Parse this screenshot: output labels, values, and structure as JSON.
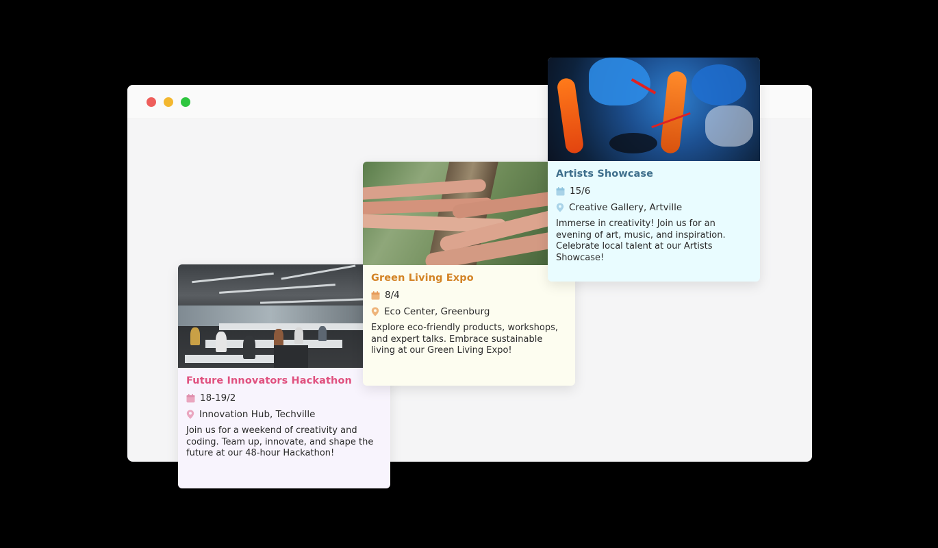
{
  "window": {
    "controls": [
      "close",
      "minimize",
      "maximize"
    ]
  },
  "events": [
    {
      "title": "Future Innovators Hackathon",
      "date": "18-19/2",
      "location": "Innovation Hub, Techville",
      "description": "Join us for a weekend of creativity and coding. Team up, innovate, and shape the future at our 48-hour Hackathon!",
      "accent": "#e0517f",
      "icon_color": "#eaa6bf",
      "background": "#f8f4fd"
    },
    {
      "title": "Green Living Expo",
      "date": "8/4",
      "location": "Eco Center, Greenburg",
      "description": "Explore eco-friendly products, workshops, and expert talks. Embrace sustainable living at our Green Living Expo!",
      "accent": "#d38426",
      "icon_color": "#eeb47a",
      "background": "#fdfdf0"
    },
    {
      "title": "Artists Showcase",
      "date": "15/6",
      "location": "Creative Gallery, Artville",
      "description": "Immerse in creativity! Join us for an evening of art, music, and inspiration. Celebrate local talent at our Artists Showcase!",
      "accent": "#3f6f8c",
      "icon_color": "#a9d3e8",
      "background": "#e9fcff"
    }
  ],
  "icons": {
    "date": "calendar-icon",
    "location": "map-pin-icon"
  }
}
